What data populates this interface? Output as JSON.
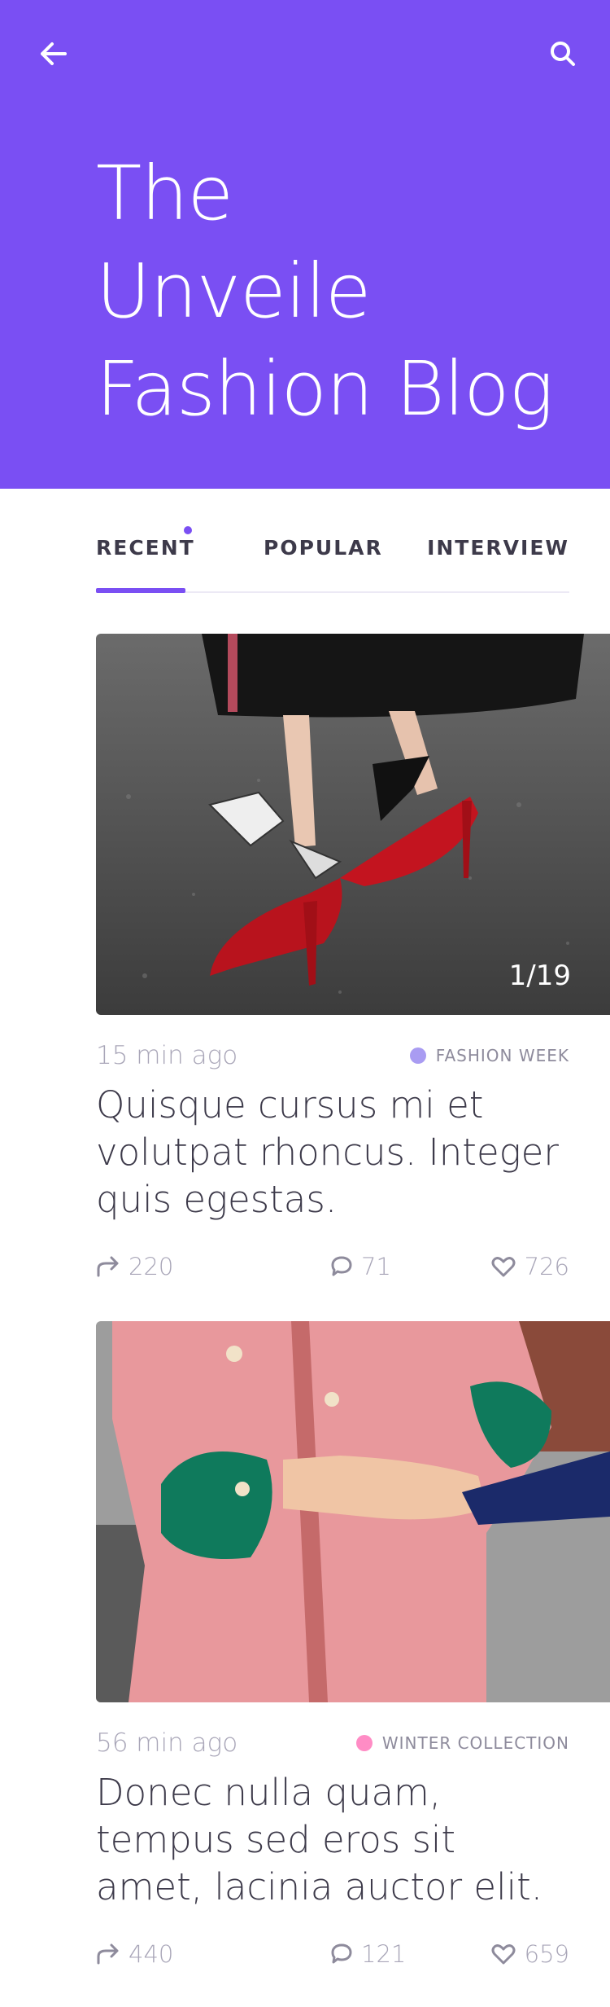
{
  "header": {
    "title_lines": [
      "The",
      "Unveile",
      "Fashion Blog"
    ],
    "back_icon": "arrow-left-icon",
    "search_icon": "search-icon",
    "bg_color": "#7a4ff3"
  },
  "tabs": [
    {
      "label": "RECENT",
      "active": true
    },
    {
      "label": "POPULAR",
      "active": false
    },
    {
      "label": "INTERVIEW",
      "active": false
    }
  ],
  "posts": [
    {
      "image_alt": "red heels with gingham ankle ties",
      "counter": "1/19",
      "time": "15 min ago",
      "category": "FASHION WEEK",
      "category_color": "#a99cf2",
      "title": "Quisque cursus mi et volutpat rhoncus. Integer quis egestas.",
      "shares": "220",
      "comments": "71",
      "likes": "726"
    },
    {
      "image_alt": "pink coat with green fur cuffs",
      "time": "56 min ago",
      "category": "WINTER COLLECTION",
      "category_color": "#ff8cc5",
      "title": "Donec nulla quam, tempus sed eros sit amet, lacinia auctor elit.",
      "shares": "440",
      "comments": "121",
      "likes": "659"
    }
  ]
}
